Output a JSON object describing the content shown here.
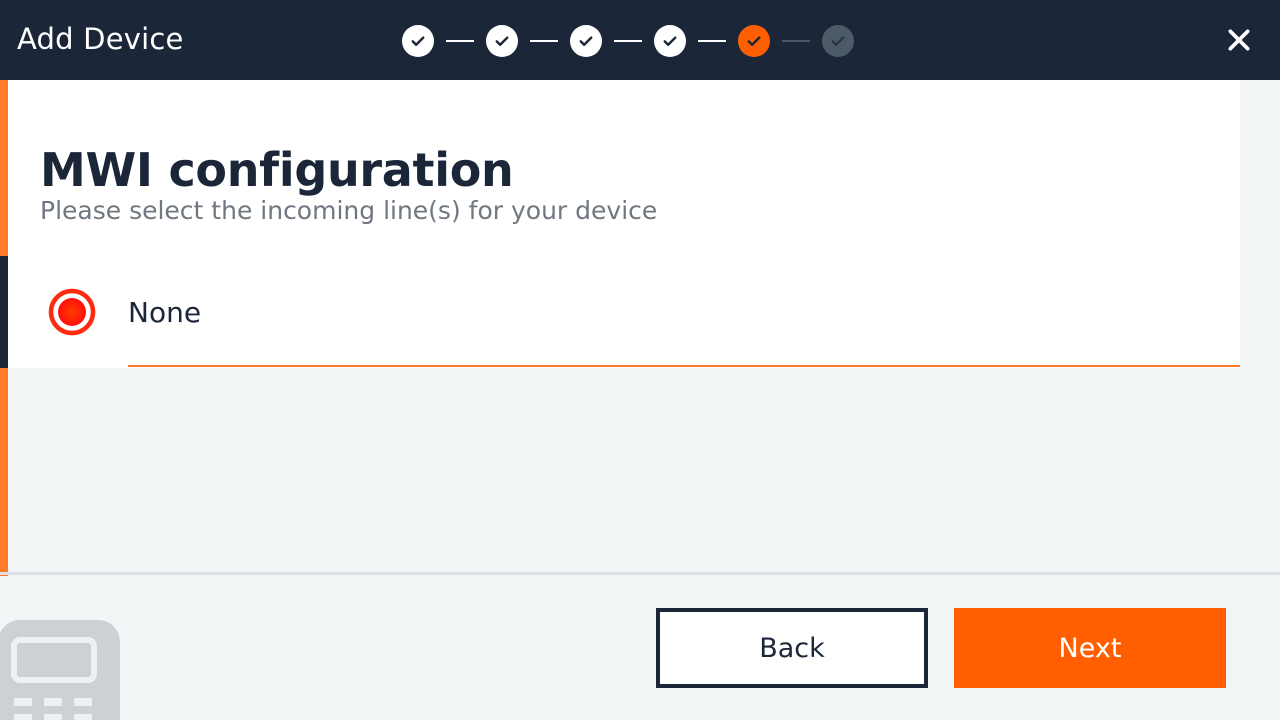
{
  "window": {
    "title": "Add Device"
  },
  "stepper": {
    "steps": [
      {
        "state": "done",
        "icon": "check-icon"
      },
      {
        "state": "done",
        "icon": "check-icon"
      },
      {
        "state": "done",
        "icon": "check-icon"
      },
      {
        "state": "done",
        "icon": "check-icon"
      },
      {
        "state": "current",
        "icon": "check-icon"
      },
      {
        "state": "pending",
        "icon": "check-icon"
      }
    ]
  },
  "page": {
    "title": "MWI configuration",
    "subtitle": "Please select the incoming line(s) for your device"
  },
  "options": [
    {
      "label": "None",
      "selected": true
    }
  ],
  "footer": {
    "back_label": "Back",
    "next_label": "Next"
  },
  "colors": {
    "header_bg": "#1b2739",
    "accent": "#ff5f00",
    "accent_light": "#ff7a2a",
    "page_bg": "#f2f5f6",
    "text_dark": "#1b2739",
    "text_muted": "#6f7780"
  }
}
